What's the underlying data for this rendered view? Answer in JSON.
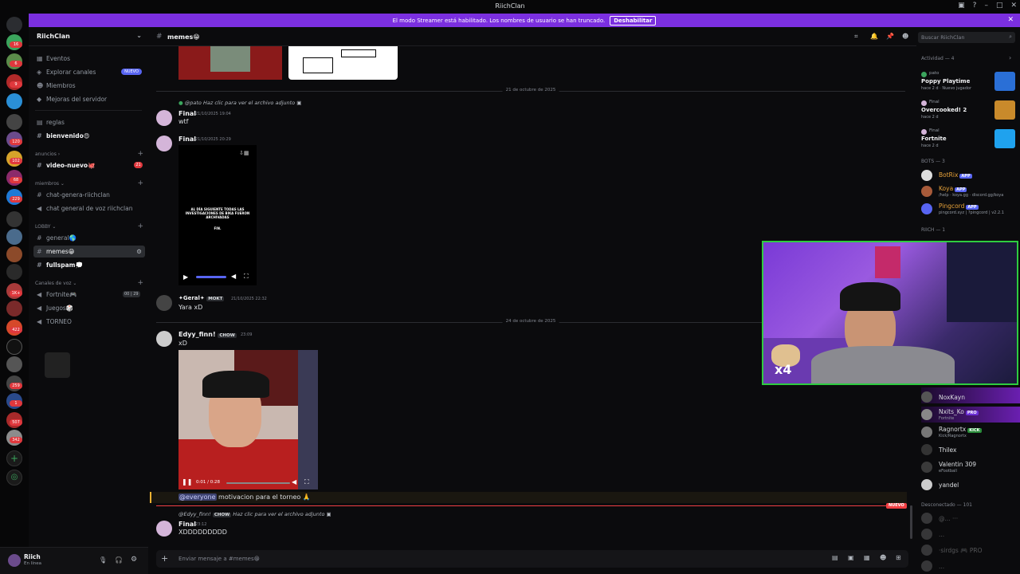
{
  "window": {
    "title": "RiichClan"
  },
  "banner": {
    "text": "El modo Streamer está habilitado. Los nombres de usuario se han truncado.",
    "button": "Deshabilitar"
  },
  "rail": {
    "badges": [
      "16",
      "6",
      "9",
      "120",
      "102",
      "68",
      "229",
      "1K+",
      "422",
      "259",
      "1",
      "507",
      "342"
    ]
  },
  "server": {
    "name": "RiichClan"
  },
  "sidebar": {
    "top": [
      {
        "label": "Eventos",
        "icon": "calendar-icon"
      },
      {
        "label": "Explorar canales",
        "icon": "compass-icon",
        "pill": "NUEVO"
      },
      {
        "label": "Miembros",
        "icon": "members-icon"
      },
      {
        "label": "Mejoras del servidor",
        "icon": "boost-icon"
      }
    ],
    "reglas": "reglas",
    "bienvenido": "bienvenido😍",
    "cat_anuncios": "anuncios",
    "video_nuevo": "video-nuevo🐙",
    "video_nuevo_badge": "21",
    "cat_miembros": "miembros",
    "chat_genera": "chat-genera-riichclan",
    "chat_voz": "chat general de voz riichclan",
    "cat_lobby": "LOBBY",
    "general": "general🌎",
    "memes": "memes😁",
    "fullspam": "fullspam💭",
    "cat_voz": "Canales de voz",
    "fortnite": "Fortnite🎮",
    "fortnite_counts": [
      "00",
      "29"
    ],
    "juegos": "Juegos🎲",
    "torneo": "TORNEO"
  },
  "user": {
    "name": "Riich",
    "status": "En línea"
  },
  "channel": {
    "name": "memes😁",
    "search_placeholder": "Buscar RiichClan"
  },
  "messages": {
    "date1": "21 de octubre de 2025",
    "m1_reply_user": "@pato",
    "m1_reply_text": "Haz clic para ver el archivo adjunto",
    "m1_user": "Final",
    "m1_time": "21/10/2025 19:04",
    "m1_text": "wtf",
    "m2_user": "Final",
    "m2_time": "21/10/2025 20:29",
    "video_caption": "AL DÍA SIGUIENTE TODAS LAS INVESTIGACIONES DE BIKA FUERON ARCHIVADAS",
    "video_caption2": "FIN.",
    "m3_user": "✦Geral✦",
    "m3_tag": "MOKT",
    "m3_time": "21/10/2025 22:32",
    "m3_text": "Yara xD",
    "date2": "24 de octubre de 2025",
    "m4_user": "Edyy_finn!",
    "m4_tag": "CHOW",
    "m4_time": "23:09",
    "m4_text": "xD",
    "video_time": "0:01 / 0:28",
    "m5_mention": "@everyone",
    "m5_text": "motivacion para el torneo 🙏",
    "new_label": "NUEVO",
    "m6_reply_user": "@Edyy_finn!",
    "m6_reply_tag": "CHOW",
    "m6_reply_text": "Haz clic para ver el archivo adjunto",
    "m6_user": "Final",
    "m6_time": "23:12",
    "m6_text": "XDDDDDDDDD"
  },
  "composer": {
    "placeholder": "Enviar mensaje a #memes😁"
  },
  "members": {
    "activity_header": "Actividad — 4",
    "activities": [
      {
        "user": "pato",
        "game": "Poppy Playtime",
        "sub": "hace 2 d · Nuevo jugador",
        "color": "#2a6fd6"
      },
      {
        "user": "Final",
        "game": "Overcooked! 2",
        "sub": "hace 2 d",
        "color": "#c98a2b"
      },
      {
        "user": "Final",
        "game": "Fortnite",
        "sub": "hace 2 d",
        "color": "#1fa2ee"
      }
    ],
    "bots_header": "BOTS — 3",
    "bots": [
      {
        "name": "BotRix",
        "status": "",
        "color": "#e8a33a"
      },
      {
        "name": "Koya",
        "status": "/help · koya.gg · discord.gg/koya",
        "color": "#e8a33a"
      },
      {
        "name": "Pingcord",
        "status": "pingcord.xyz | ?pingcord | v2.2.1",
        "color": "#e8a33a"
      }
    ],
    "app_label": "APP",
    "riich_header": "RIICH — 1",
    "online": [
      {
        "name": "NoxKayn",
        "status": ""
      },
      {
        "name": "Nxits_Ko",
        "status": "Fortnite",
        "tag": "PRO"
      },
      {
        "name": "Ragnortx",
        "status": "Kick/Ragnortx",
        "tag": "KICK"
      },
      {
        "name": "Thilex",
        "status": ""
      },
      {
        "name": "Valentin 309",
        "status": "eFootball"
      },
      {
        "name": "yandel",
        "status": ""
      }
    ],
    "offline_header": "Desconectado — 101",
    "offline": [
      "@... ···",
      "...",
      "·sirdgs 🎮 PRO",
      "..."
    ]
  },
  "webcam": {
    "overlay": "x4"
  }
}
